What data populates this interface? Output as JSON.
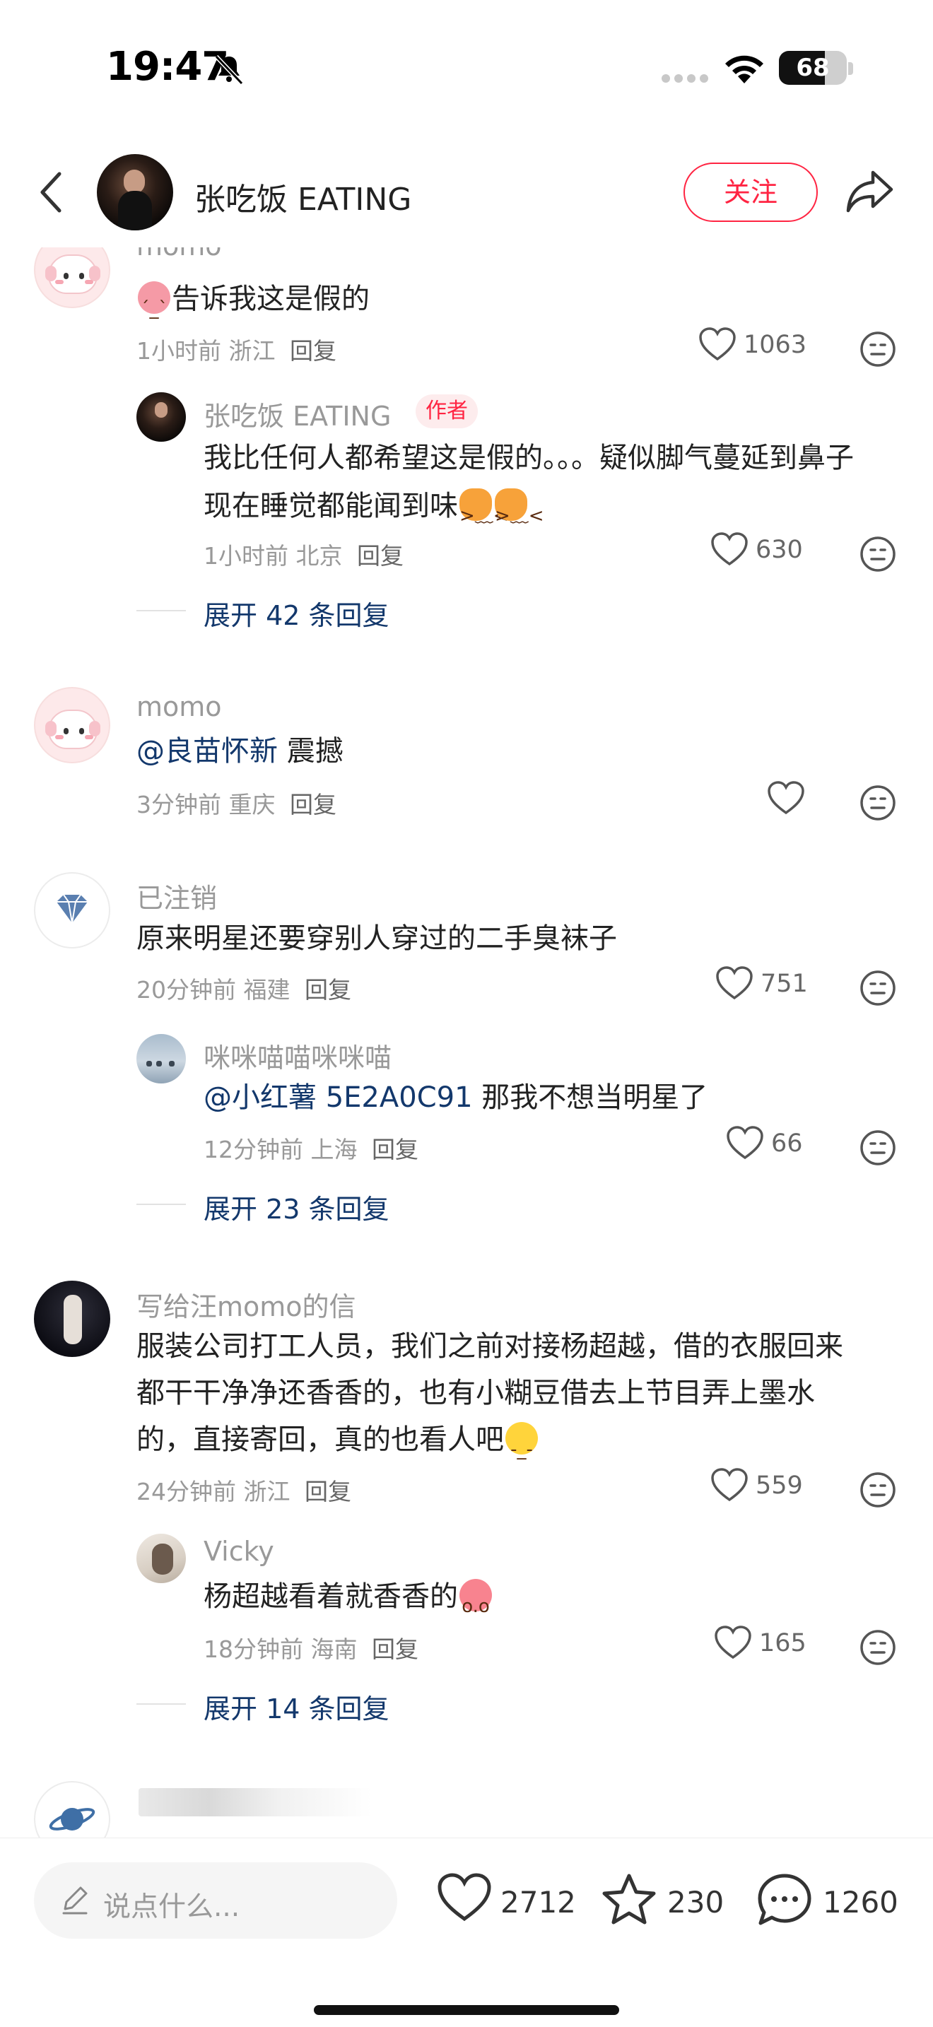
{
  "status_bar": {
    "time": "19:47",
    "battery": "68",
    "battery_level": 0.68
  },
  "header": {
    "author_name": "张吃饭 EATING",
    "follow_label": "关注"
  },
  "comments": [
    {
      "user": "momo",
      "text": "告诉我这是假的",
      "time": "1小时前",
      "location": "浙江",
      "reply_label": "回复",
      "likes": "1063",
      "replies": [
        {
          "user": "张吃饭 EATING",
          "tag": "作者",
          "text_line1": "我比任何人都希望这是假的。。。疑似脚气蔓延到鼻子",
          "text_line2": "现在睡觉都能闻到味",
          "time": "1小时前",
          "location": "北京",
          "reply_label": "回复",
          "likes": "630"
        }
      ],
      "expand_label": "展开 42 条回复"
    },
    {
      "user": "momo",
      "mention": "@良苗怀新",
      "text": " 震撼",
      "time": "3分钟前",
      "location": "重庆",
      "reply_label": "回复",
      "likes": ""
    },
    {
      "user": "已注销",
      "text": "原来明星还要穿别人穿过的二手臭袜子",
      "time": "20分钟前",
      "location": "福建",
      "reply_label": "回复",
      "likes": "751",
      "replies": [
        {
          "user": "咪咪喵喵咪咪喵",
          "mention": "@小红薯 5E2A0C91",
          "text": " 那我不想当明星了",
          "time": "12分钟前",
          "location": "上海",
          "reply_label": "回复",
          "likes": "66"
        }
      ],
      "expand_label": "展开 23 条回复"
    },
    {
      "user": "写给汪momo的信",
      "text_line1": "服装公司打工人员，我们之前对接杨超越，借的衣服回来",
      "text_line2": "都干干净净还香香的，也有小糊豆借去上节目弄上墨水",
      "text_line3": "的，直接寄回，真的也看人吧",
      "time": "24分钟前",
      "location": "浙江",
      "reply_label": "回复",
      "likes": "559",
      "replies": [
        {
          "user": "Vicky",
          "text": "杨超越看着就香香的",
          "time": "18分钟前",
          "location": "海南",
          "reply_label": "回复",
          "likes": "165"
        }
      ],
      "expand_label": "展开 14 条回复"
    }
  ],
  "bottom_bar": {
    "input_placeholder": "说点什么...",
    "likes": "2712",
    "favorites": "230",
    "comments": "1260"
  },
  "colors": {
    "accent": "#ff2442",
    "mention": "#13386c",
    "muted": "#999999"
  },
  "icons": [
    "back-icon",
    "share-icon",
    "heart-icon",
    "neutral-face-icon",
    "star-icon",
    "chat-bubble-icon",
    "pencil-icon",
    "wifi-icon",
    "bell-slash-icon"
  ]
}
